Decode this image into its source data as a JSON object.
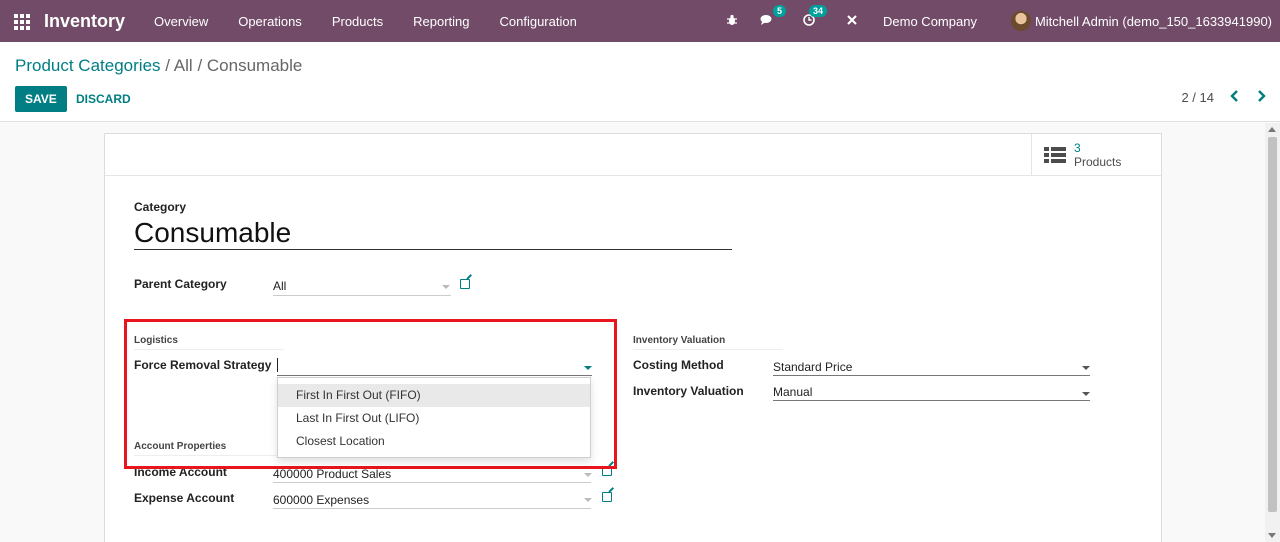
{
  "navbar": {
    "app_name": "Inventory",
    "menu": [
      "Overview",
      "Operations",
      "Products",
      "Reporting",
      "Configuration"
    ],
    "messages_count": "5",
    "activities_count": "34",
    "company": "Demo Company",
    "user": "Mitchell Admin (demo_150_1633941990)",
    "icons": [
      "apps-icon",
      "bug-icon",
      "chat-icon",
      "clock-icon",
      "tools-icon"
    ],
    "bg_color": "#714b67"
  },
  "control_panel": {
    "breadcrumb_parent": "Product Categories",
    "breadcrumb_sep1": "/",
    "breadcrumb_middle": "All",
    "breadcrumb_sep2": "/",
    "breadcrumb_current": "Consumable",
    "save_label": "SAVE",
    "discard_label": "DISCARD",
    "pager": "2 / 14",
    "accent_color": "#017e84"
  },
  "form": {
    "smart_button": {
      "count": "3",
      "label": "Products"
    },
    "category_label": "Category",
    "category_name": "Consumable",
    "parent_category_label": "Parent Category",
    "parent_category_value": "All",
    "logistics": {
      "title": "Logistics",
      "removal_strategy_label": "Force Removal Strategy",
      "removal_strategy_value": "",
      "options": [
        "First In First Out (FIFO)",
        "Last In First Out (LIFO)",
        "Closest Location"
      ],
      "active_option_index": 0
    },
    "inventory_valuation": {
      "title": "Inventory Valuation",
      "costing_method_label": "Costing Method",
      "costing_method_value": "Standard Price",
      "valuation_label": "Inventory Valuation",
      "valuation_value": "Manual"
    },
    "account_properties": {
      "title": "Account Properties",
      "income_label": "Income Account",
      "income_value": "400000 Product Sales",
      "expense_label": "Expense Account",
      "expense_value": "600000 Expenses"
    },
    "highlight_color": "#e8151e"
  }
}
